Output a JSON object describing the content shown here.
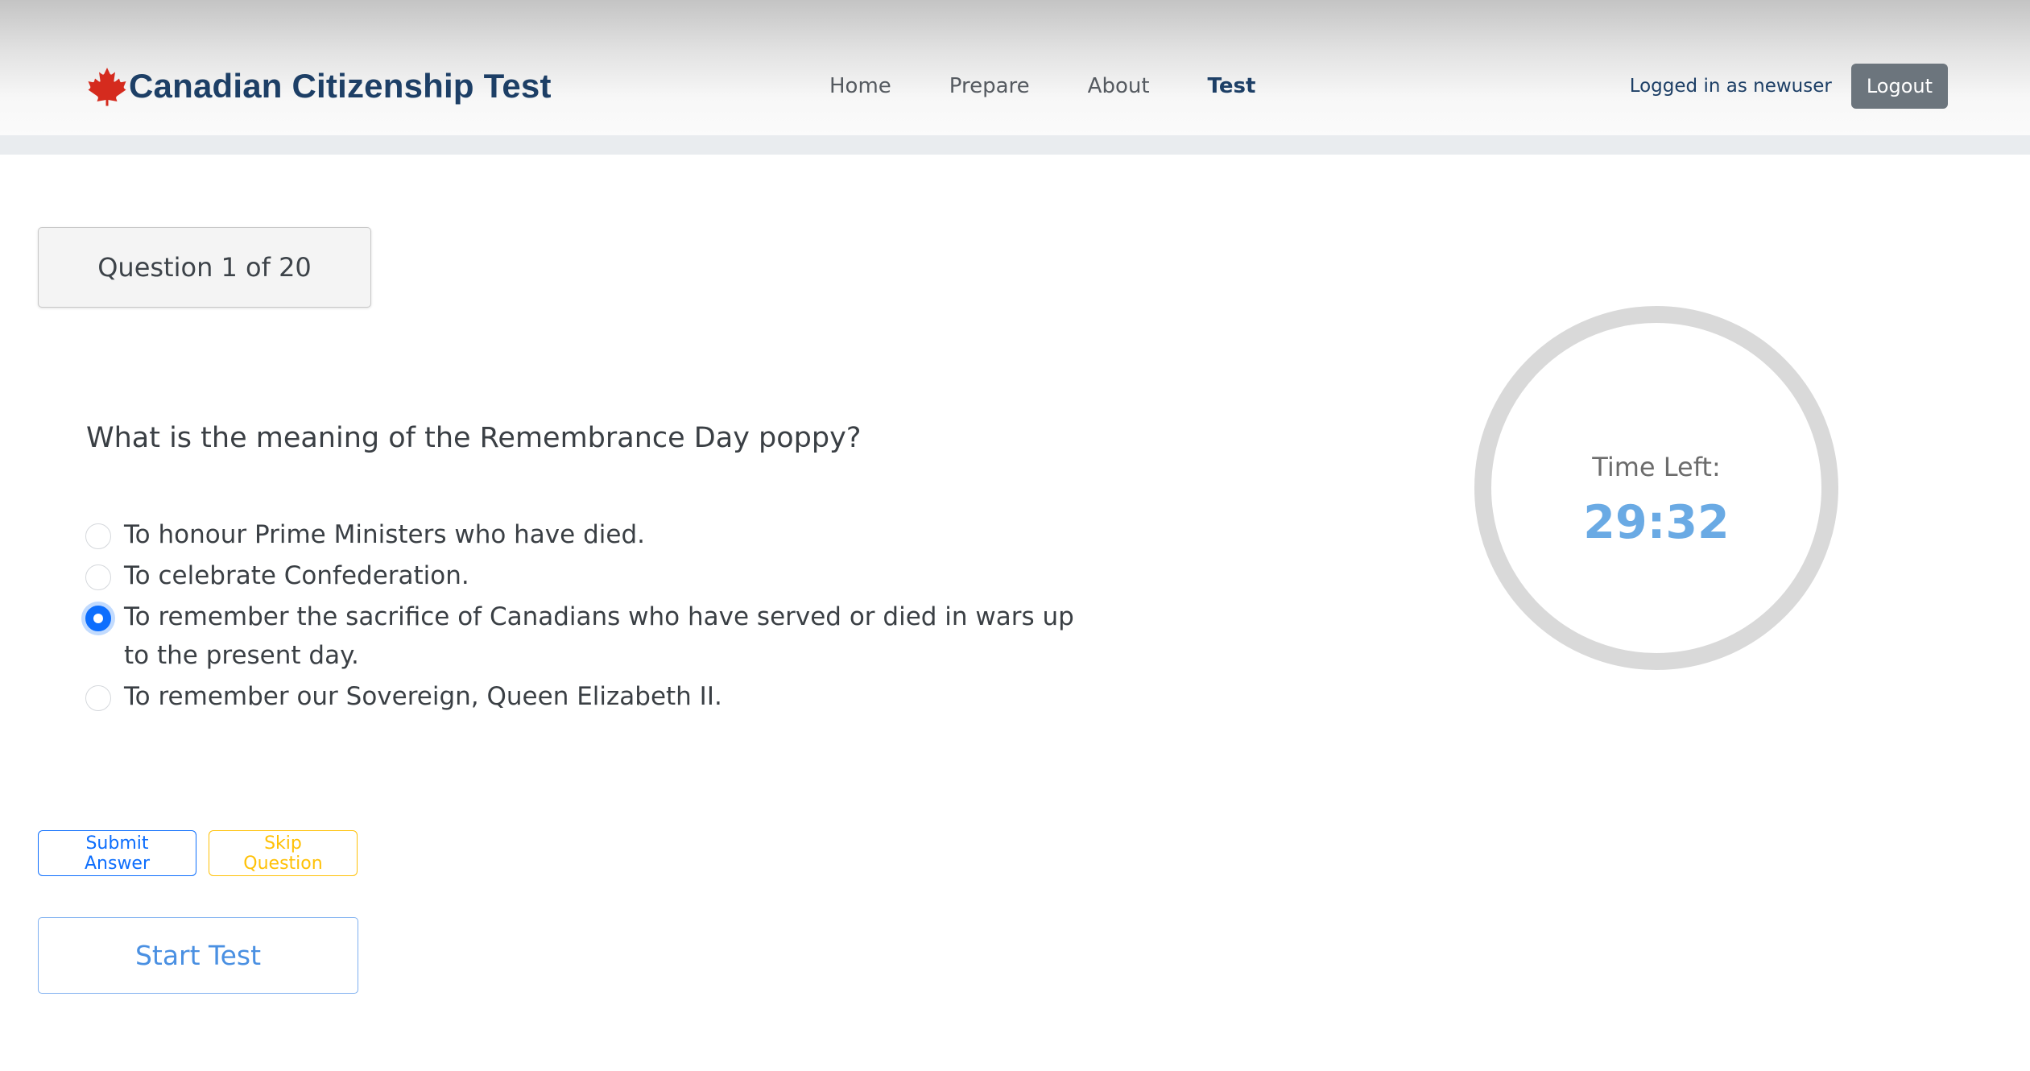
{
  "app": {
    "brand_title": "Canadian Citizenship Test",
    "brand_icon": "maple-leaf-icon",
    "brand_icon_color": "#d52b1e",
    "brand_color": "#1d3f66"
  },
  "nav": {
    "items": [
      {
        "label": "Home",
        "active": false
      },
      {
        "label": "Prepare",
        "active": false
      },
      {
        "label": "About",
        "active": false
      },
      {
        "label": "Test",
        "active": true
      }
    ]
  },
  "user": {
    "status_text": "Logged in as newuser",
    "logout_label": "Logout"
  },
  "quiz": {
    "counter_text": "Question 1 of 20",
    "question": "What is the meaning of the Remembrance Day poppy?",
    "options": [
      {
        "label": "To honour Prime Ministers who have died.",
        "selected": false
      },
      {
        "label": "To celebrate Confederation.",
        "selected": false
      },
      {
        "label": "To remember the sacrifice of Canadians who have served or died in wars up to the present day.",
        "selected": true
      },
      {
        "label": "To remember our Sovereign, Queen Elizabeth II.",
        "selected": false
      }
    ],
    "submit_label": "Submit Answer",
    "skip_label": "Skip Question",
    "start_label": "Start Test"
  },
  "timer": {
    "label": "Time Left:",
    "value": "29:32"
  },
  "colors": {
    "primary": "#0d6efd",
    "warning": "#ffc107",
    "secondary": "#6c757d",
    "timer_value": "#6aaae4"
  }
}
